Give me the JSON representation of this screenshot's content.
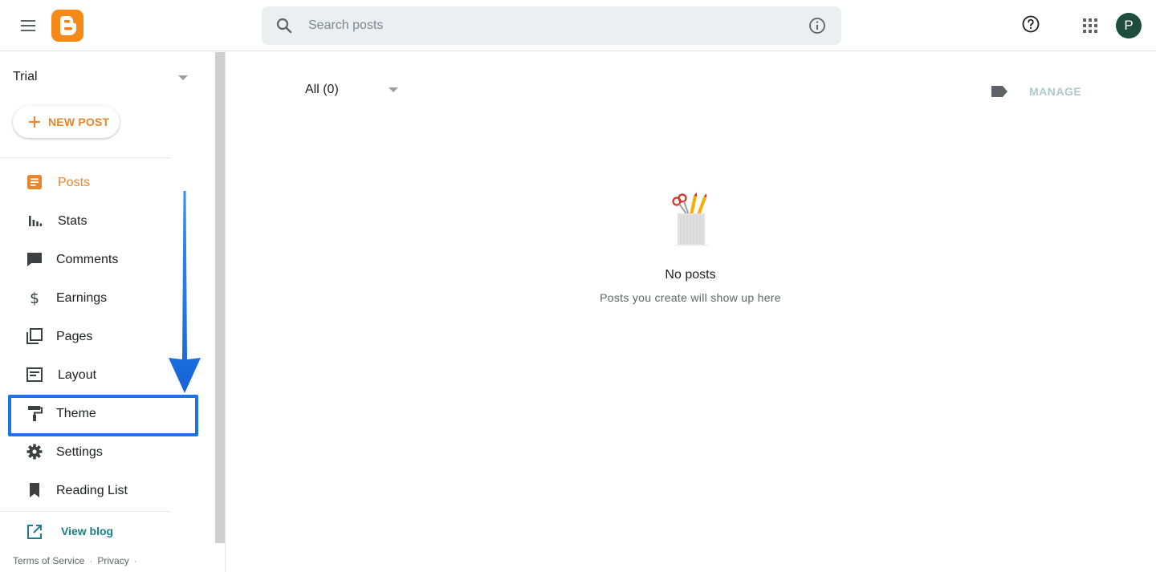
{
  "header": {
    "search_placeholder": "Search posts",
    "avatar_letter": "P"
  },
  "sidebar": {
    "blog_name": "Trial",
    "new_post_label": "NEW POST",
    "items": [
      {
        "label": "Posts",
        "icon": "posts-icon",
        "active": true
      },
      {
        "label": "Stats",
        "icon": "stats-icon"
      },
      {
        "label": "Comments",
        "icon": "comments-icon"
      },
      {
        "label": "Earnings",
        "icon": "dollar-icon"
      },
      {
        "label": "Pages",
        "icon": "pages-icon"
      },
      {
        "label": "Layout",
        "icon": "layout-icon"
      },
      {
        "label": "Theme",
        "icon": "paint-roller-icon",
        "highlighted": true
      },
      {
        "label": "Settings",
        "icon": "gear-icon"
      },
      {
        "label": "Reading List",
        "icon": "bookmark-icon"
      }
    ],
    "view_blog_label": "View blog",
    "footer": {
      "terms": "Terms of Service",
      "privacy": "Privacy"
    }
  },
  "main": {
    "filter_label": "All (0)",
    "manage_label": "MANAGE",
    "empty_title": "No posts",
    "empty_subtitle": "Posts you create will show up here"
  },
  "colors": {
    "accent": "#e8852d",
    "highlight": "#1a73e8",
    "link": "#1a7f86",
    "avatar": "#1e4d3d"
  }
}
